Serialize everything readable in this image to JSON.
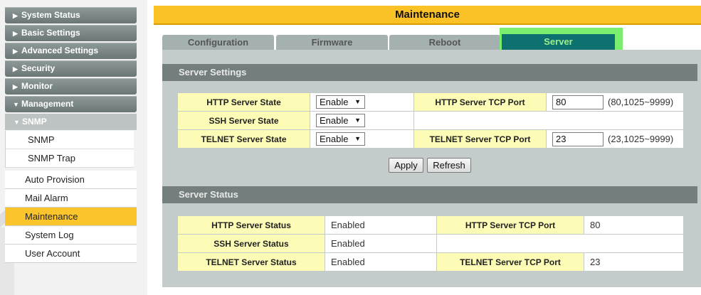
{
  "sidebar": {
    "categories": [
      {
        "label": "System Status",
        "arrow": "▶"
      },
      {
        "label": "Basic Settings",
        "arrow": "▶"
      },
      {
        "label": "Advanced Settings",
        "arrow": "▶"
      },
      {
        "label": "Security",
        "arrow": "▶"
      },
      {
        "label": "Monitor",
        "arrow": "▶"
      },
      {
        "label": "Management",
        "arrow": "▼"
      }
    ],
    "sub_category": {
      "label": "SNMP",
      "arrow": "▼"
    },
    "sub_items": [
      "SNMP",
      "SNMP Trap"
    ],
    "items": [
      "Auto Provision",
      "Mail Alarm",
      "Maintenance",
      "System Log",
      "User Account"
    ],
    "active_item": "Maintenance"
  },
  "header": {
    "title": "Maintenance"
  },
  "tabs": {
    "configuration": "Configuration",
    "firmware": "Firmware",
    "reboot": "Reboot",
    "server": "Server",
    "active": "Server"
  },
  "server_settings": {
    "title": "Server Settings",
    "http_state_label": "HTTP Server State",
    "http_state_value": "Enable",
    "http_port_label": "HTTP Server TCP Port",
    "http_port_value": "80",
    "http_port_hint": "(80,1025~9999)",
    "ssh_state_label": "SSH Server State",
    "ssh_state_value": "Enable",
    "telnet_state_label": "TELNET Server State",
    "telnet_state_value": "Enable",
    "telnet_port_label": "TELNET Server TCP Port",
    "telnet_port_value": "23",
    "telnet_port_hint": "(23,1025~9999)",
    "apply_label": "Apply",
    "refresh_label": "Refresh"
  },
  "server_status": {
    "title": "Server Status",
    "http_status_label": "HTTP Server Status",
    "http_status_value": "Enabled",
    "http_port_label": "HTTP Server TCP Port",
    "http_port_value": "80",
    "ssh_status_label": "SSH Server Status",
    "ssh_status_value": "Enabled",
    "telnet_status_label": "TELNET Server Status",
    "telnet_status_value": "Enabled",
    "telnet_port_label": "TELNET Server TCP Port",
    "telnet_port_value": "23"
  },
  "colors": {
    "accent": "#fbc227",
    "active_tab": "#0d716f",
    "tab_highlight": "#7aec6e",
    "label_cell": "#fdfcb7",
    "section_bar": "#737e7d"
  },
  "icons": {
    "collapsed_arrow": "triangle-right-icon",
    "expanded_arrow": "triangle-down-icon",
    "select_arrow": "chevron-down-icon"
  }
}
